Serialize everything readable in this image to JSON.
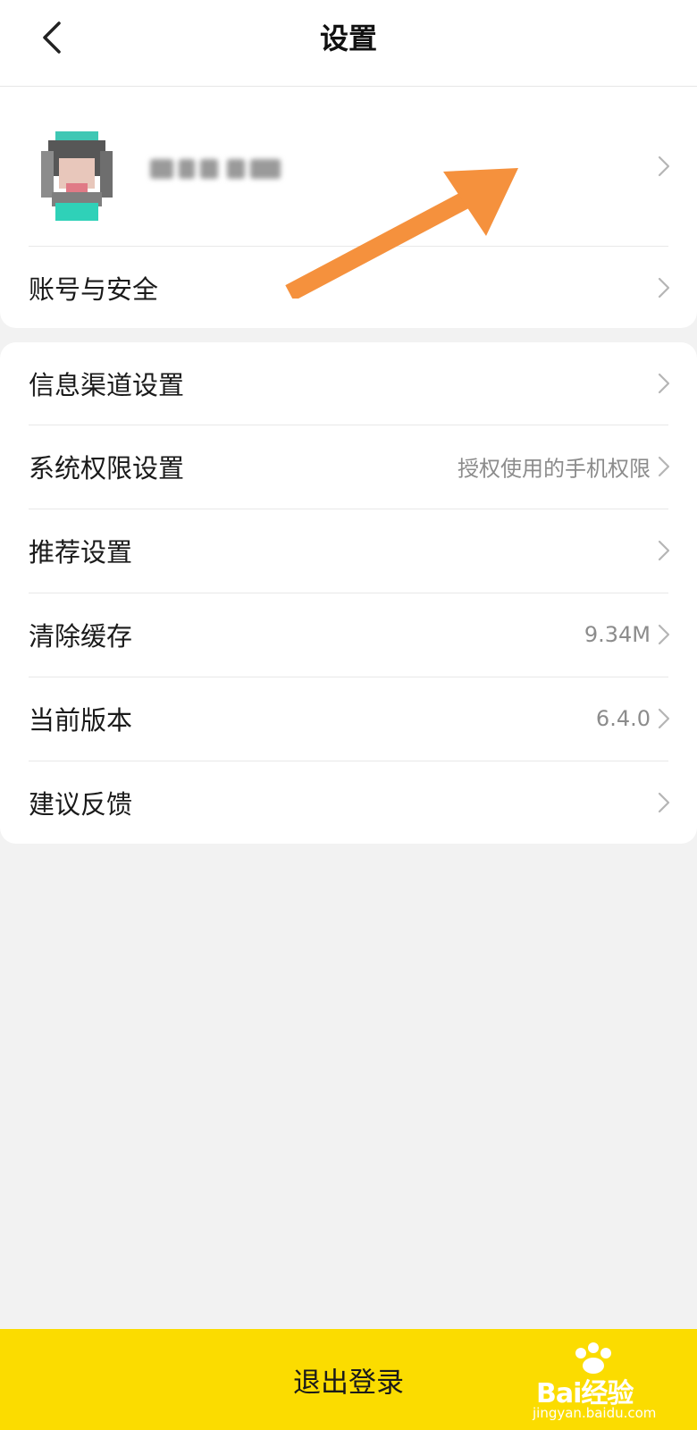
{
  "header": {
    "title": "设置"
  },
  "profile": {
    "nickname_hidden": true
  },
  "section1": {
    "items": [
      {
        "label": "账号与安全",
        "value": ""
      }
    ]
  },
  "section2": {
    "items": [
      {
        "label": "信息渠道设置",
        "value": ""
      },
      {
        "label": "系统权限设置",
        "value": "授权使用的手机权限"
      },
      {
        "label": "推荐设置",
        "value": ""
      },
      {
        "label": "清除缓存",
        "value": "9.34M"
      },
      {
        "label": "当前版本",
        "value": "6.4.0"
      },
      {
        "label": "建议反馈",
        "value": ""
      }
    ]
  },
  "footer": {
    "logout_label": "退出登录"
  },
  "watermark": {
    "brand": "Bai经验",
    "url": "jingyan.baidu.com"
  },
  "colors": {
    "accent": "#fbdc00",
    "annotation_arrow": "#f5913d",
    "background": "#f2f2f2"
  },
  "icons": {
    "back": "chevron-left-icon",
    "row_arrow": "chevron-right-icon"
  }
}
